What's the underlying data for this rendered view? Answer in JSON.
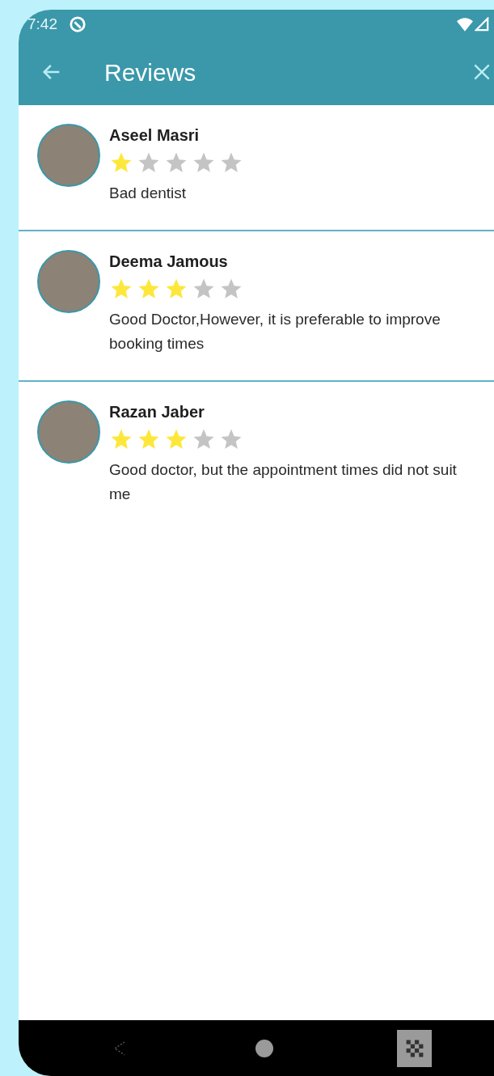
{
  "status_bar": {
    "time": "7:42"
  },
  "app_bar": {
    "title": "Reviews"
  },
  "reviews": [
    {
      "name": "Aseel Masri",
      "stars": 1,
      "text": "Bad dentist"
    },
    {
      "name": "Deema Jamous",
      "stars": 3,
      "text": "Good Doctor,However, it is preferable to improve booking times"
    },
    {
      "name": "Razan Jaber",
      "stars": 3,
      "text": "Good doctor, but the appointment times did not suit me"
    }
  ]
}
